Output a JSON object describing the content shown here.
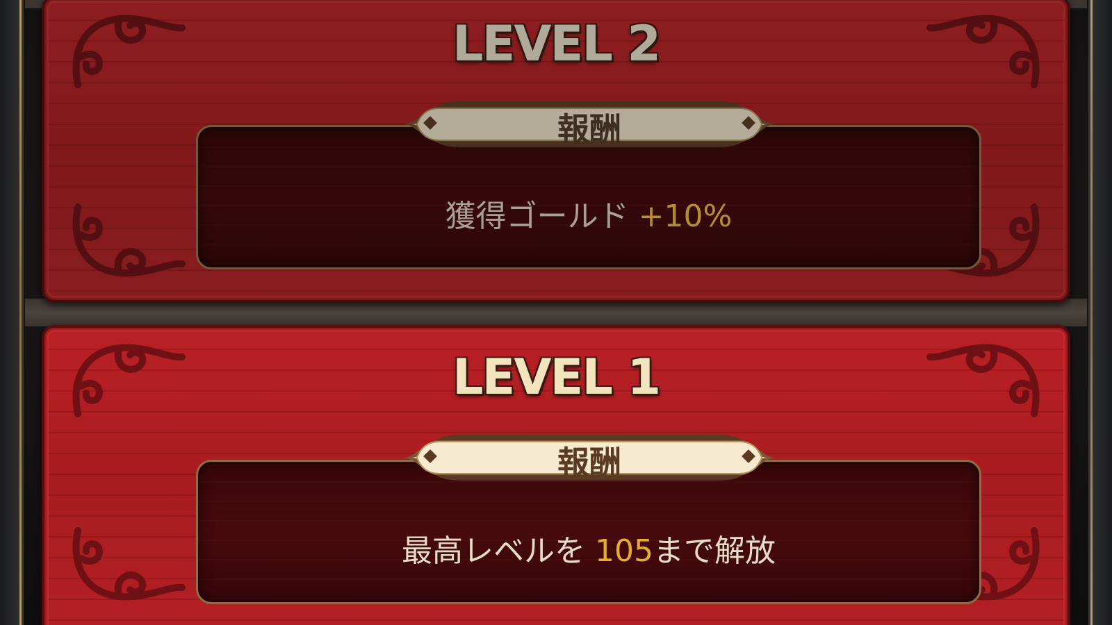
{
  "cards": [
    {
      "level_title": "LEVEL 2",
      "reward_label": "報酬",
      "reward_prefix": "獲得ゴールド ",
      "reward_highlight": "+10%",
      "reward_suffix": ""
    },
    {
      "level_title": "LEVEL 1",
      "reward_label": "報酬",
      "reward_prefix": "最高レベルを ",
      "reward_highlight": "105",
      "reward_suffix": "まで解放"
    }
  ],
  "colors": {
    "card_red": "#b81d22",
    "panel_dark": "#3c0709",
    "highlight_gold": "#e3ae2a",
    "title_cream": "#f3e4c0"
  },
  "icons": [
    "scroll-ornament-icon",
    "diamond-icon"
  ]
}
